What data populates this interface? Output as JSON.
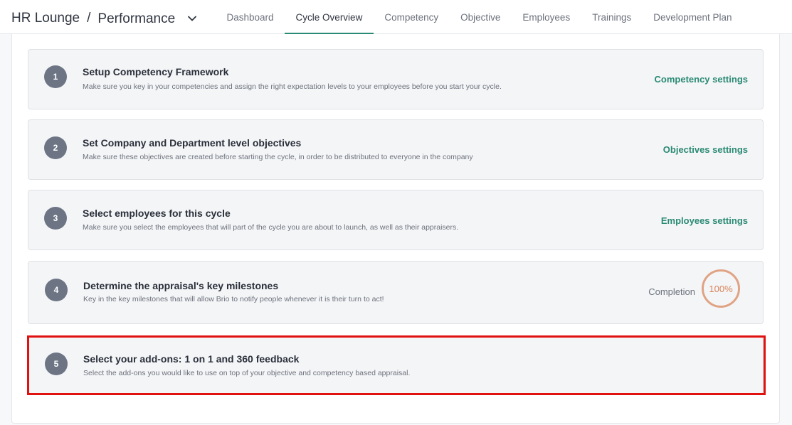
{
  "header": {
    "app_name": "HR Lounge",
    "separator": "/",
    "module": "Performance",
    "module_dropdown_icon": "chevron-down-icon"
  },
  "tabs": [
    {
      "label": "Dashboard",
      "active": false
    },
    {
      "label": "Cycle Overview",
      "active": true
    },
    {
      "label": "Competency",
      "active": false
    },
    {
      "label": "Objective",
      "active": false
    },
    {
      "label": "Employees",
      "active": false
    },
    {
      "label": "Trainings",
      "active": false
    },
    {
      "label": "Development Plan",
      "active": false
    }
  ],
  "steps": [
    {
      "number": "1",
      "title": "Setup Competency Framework",
      "description": "Make sure you key in your competencies and assign the right expectation levels to your employees before you start your cycle.",
      "link": "Competency settings"
    },
    {
      "number": "2",
      "title": "Set Company and Department level objectives",
      "description": "Make sure these objectives are created before starting the cycle, in order to be distributed to everyone in the company",
      "link": "Objectives settings"
    },
    {
      "number": "3",
      "title": "Select employees for this cycle",
      "description": "Make sure you select the employees that will part of the cycle you are about to launch, as well as their appraisers.",
      "link": "Employees settings"
    },
    {
      "number": "4",
      "title": "Determine the appraisal's key milestones",
      "description": "Key in the key milestones that will allow Brio to notify people whenever it is their turn to act!",
      "completion_label": "Completion",
      "completion_value": "100%"
    },
    {
      "number": "5",
      "title": "Select your add-ons: 1 on 1 and 360 feedback",
      "description": "Select the add-ons you would like to use on top of your objective and competency based appraisal."
    }
  ],
  "colors": {
    "accent": "#2a8a74",
    "step_badge": "#6d7585",
    "completion": "#d9835a",
    "highlight": "#e0120f"
  }
}
